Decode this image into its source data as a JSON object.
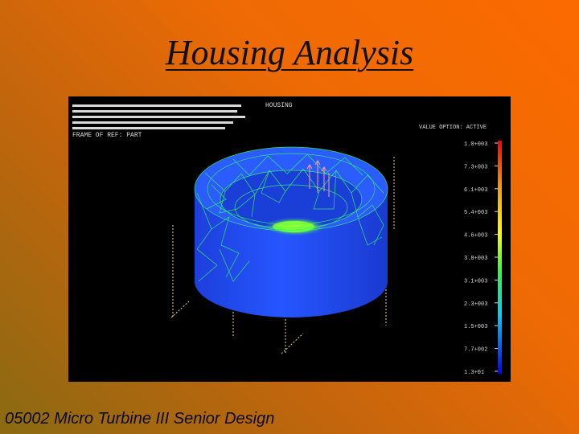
{
  "slide": {
    "title": "Housing Analysis",
    "footer": "05002 Micro Turbine III Senior Design"
  },
  "viewport": {
    "frame_label": "FRAME OF REF: PART",
    "model_label": "HOUSING",
    "legend_title": "VALUE OPTION: ACTIVE",
    "legend_values": [
      "1.0+003",
      "7.3+003",
      "6.1+003",
      "5.4+003",
      "4.6+003",
      "3.8+003",
      "3.1+003",
      "2.3+003",
      "1.5+003",
      "7.7+002",
      "1.3+01"
    ],
    "colors": {
      "mesh": "#33ff55",
      "body": "#1f4cff",
      "highlight": "#55ff33",
      "legend_top": "#ff0000",
      "legend_bottom": "#0000ff"
    }
  }
}
